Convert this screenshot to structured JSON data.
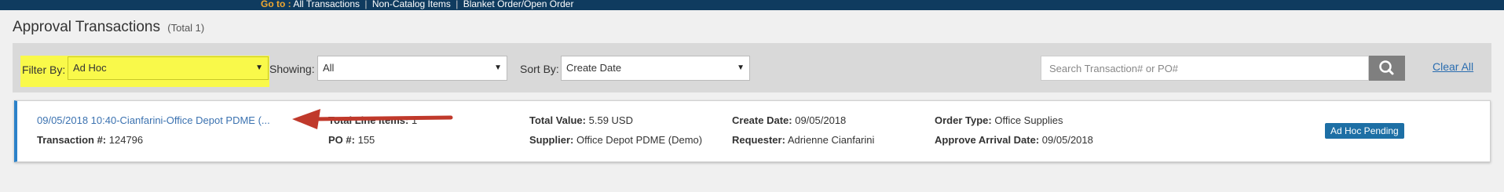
{
  "topbar": {
    "goto": "Go to :",
    "links": [
      "All Transactions",
      "Non-Catalog Items",
      "Blanket Order/Open Order"
    ]
  },
  "page": {
    "title": "Approval Transactions",
    "count": "(Total 1)"
  },
  "filters": {
    "filter_by_label": "Filter By:",
    "filter_by_value": "Ad Hoc",
    "showing_label": "Showing:",
    "showing_value": "All",
    "sort_by_label": "Sort By:",
    "sort_by_value": "Create Date",
    "search_placeholder": "Search Transaction# or PO#",
    "clear_all": "Clear All"
  },
  "transaction": {
    "title": "09/05/2018 10:40-Cianfarini-Office Depot PDME (...",
    "transaction_no_label": "Transaction #:",
    "transaction_no": "124796",
    "total_line_items_label": "Total Line Items:",
    "total_line_items": "1",
    "po_label": "PO #:",
    "po": "155",
    "total_value_label": "Total Value:",
    "total_value": "5.59 USD",
    "supplier_label": "Supplier:",
    "supplier": "Office Depot PDME (Demo)",
    "create_date_label": "Create Date:",
    "create_date": "09/05/2018",
    "requester_label": "Requester:",
    "requester": "Adrienne Cianfarini",
    "order_type_label": "Order Type:",
    "order_type": "Office Supplies",
    "approve_arrival_label": "Approve Arrival Date:",
    "approve_arrival": "09/05/2018",
    "status_badge": "Ad Hoc Pending"
  },
  "colors": {
    "topbar": "#0f3b5f",
    "highlight": "#f9f94a",
    "accent": "#2c82c9",
    "badge": "#1d6fa5",
    "annotation_arrow": "#c0392b"
  },
  "icons": {
    "search": "search-icon",
    "dropdown": "chevron-down-icon",
    "annotation": "red-arrow"
  }
}
